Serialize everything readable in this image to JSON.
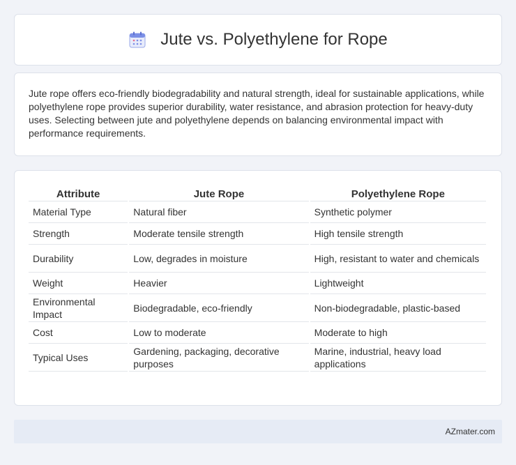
{
  "header": {
    "title": "Jute vs. Polyethylene for Rope",
    "icon": "calendar-icon"
  },
  "intro": {
    "text": "Jute rope offers eco-friendly biodegradability and natural strength, ideal for sustainable applications, while polyethylene rope provides superior durability, water resistance, and abrasion protection for heavy-duty uses. Selecting between jute and polyethylene depends on balancing environmental impact with performance requirements."
  },
  "table": {
    "headers": [
      "Attribute",
      "Jute Rope",
      "Polyethylene Rope"
    ],
    "rows": [
      [
        "Material Type",
        "Natural fiber",
        "Synthetic polymer"
      ],
      [
        "Strength",
        "Moderate tensile strength",
        "High tensile strength"
      ],
      [
        "Durability",
        "Low, degrades in moisture",
        "High, resistant to water and chemicals"
      ],
      [
        "Weight",
        "Heavier",
        "Lightweight"
      ],
      [
        "Environmental Impact",
        "Biodegradable, eco-friendly",
        "Non-biodegradable, plastic-based"
      ],
      [
        "Cost",
        "Low to moderate",
        "Moderate to high"
      ],
      [
        "Typical Uses",
        "Gardening, packaging, decorative purposes",
        "Marine, industrial, heavy load applications"
      ]
    ]
  },
  "footer": {
    "text": "AZmater.com"
  },
  "colors": {
    "background": "#f1f3f8",
    "card": "#ffffff",
    "footer": "#e6ebf5",
    "icon_accent": "#7b8fe6"
  }
}
